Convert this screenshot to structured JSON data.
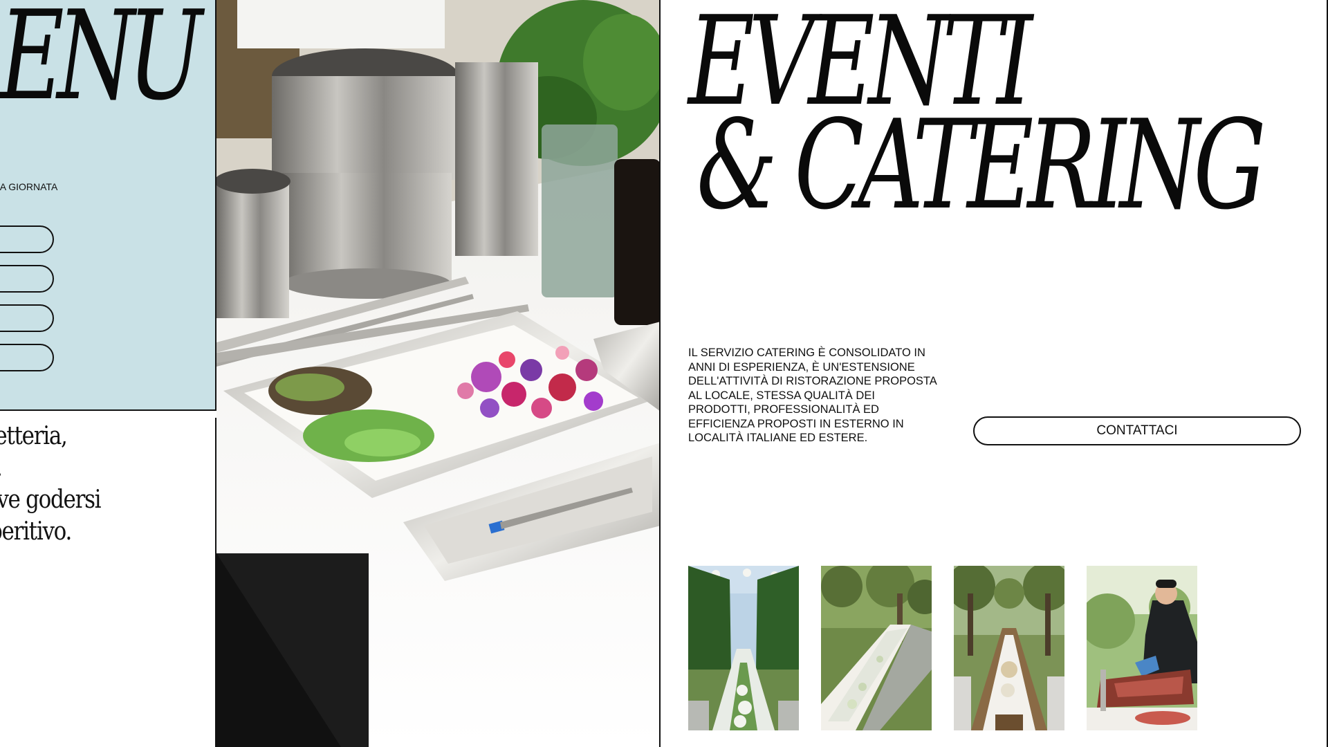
{
  "menu_panel": {
    "title": "ENU",
    "subtitle": "LA GIORNATA",
    "background": "#c9e1e6"
  },
  "left_text": {
    "lines": [
      "ffetteria,",
      ".",
      "ove godersi",
      "peritivo."
    ]
  },
  "hero": {
    "line1": "EVENTI",
    "line2": "& CATERING"
  },
  "intro": {
    "text": "IL SERVIZIO CATERING È CONSOLIDATO IN ANNI DI ESPERIENZA, È UN'ESTENSIONE DELL'ATTIVITÀ DI RISTORAZIONE PROPOSTA AL LOCALE, STESSA QUALITÀ DEI PRODOTTI, PROFESSIONALITÀ ED EFFICIENZA PROPOSTI IN ESTERNO IN LOCALITÀ ITALIANE ED ESTERE."
  },
  "contact": {
    "label": "CONTATTACI"
  },
  "colors": {
    "ink": "#111111",
    "menu_bg": "#c9e1e6",
    "page_bg": "#ffffff"
  }
}
